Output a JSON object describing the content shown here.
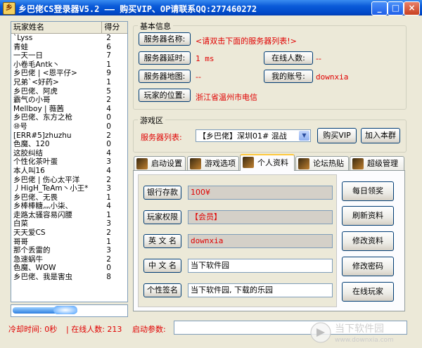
{
  "title": "乡巴佬CS登录器V5.2 —— 购买VIP、OP请联系QQ:277460272",
  "window_controls": {
    "min": "_",
    "max": "□",
    "close": "×"
  },
  "players": {
    "headers": [
      "玩家姓名",
      "得分"
    ],
    "rows": [
      [
        "`Lyss",
        "2"
      ],
      [
        "青蛙",
        "6"
      ],
      [
        "一天一日",
        "7"
      ],
      [
        "小卷毛Antk丶",
        "1"
      ],
      [
        "乡巴佬 | <恩平仔>",
        "9"
      ],
      [
        "兄弟`<好药>",
        "1"
      ],
      [
        "乡巴佬、阿虎",
        "5"
      ],
      [
        "霸气の小哥",
        "2"
      ],
      [
        "Mellboy | 薇茜",
        "4"
      ],
      [
        "乡巴佬、东方之枪",
        "0"
      ],
      [
        "⑩号",
        "0"
      ],
      [
        "[ERR#5]zhuzhu",
        "2"
      ],
      [
        "色魔、120",
        "0"
      ],
      [
        "这胶纠结",
        "4"
      ],
      [
        "个性化茶叶蛋",
        "3"
      ],
      [
        "本人叫16",
        "4"
      ],
      [
        "乡巴佬 | 伤心太平洋",
        "2"
      ],
      [
        "丿HigH_TeAm丶小王*",
        "3"
      ],
      [
        "乡巴佬、无畏",
        "1"
      ],
      [
        "乡棒棒糖灬小柒、",
        "4"
      ],
      [
        "走路太骚容易闪腰",
        "1"
      ],
      [
        "白菜",
        "3"
      ],
      [
        "天天爱CS",
        "2"
      ],
      [
        "哥哥",
        "1"
      ],
      [
        "那个丢雷的",
        "3"
      ],
      [
        "急速蜗牛",
        "2"
      ],
      [
        "色魔、WOW",
        "0"
      ],
      [
        "乡巴佬、我是害虫",
        "8"
      ]
    ]
  },
  "progress_fraction": 0.58,
  "basic_info": {
    "title": "基本信息",
    "server_name_label": "服务器名称:",
    "server_name_value": "<请双击下面的服务器列表!>",
    "latency_label": "服务器延时:",
    "latency_value": "1 ms",
    "online_label": "在线人数:",
    "online_value": "--",
    "map_label": "服务器地图:",
    "map_value": "--",
    "account_label": "我的账号:",
    "account_value": "downxia",
    "location_label": "玩家的位置:",
    "location_value": "浙江省温州市电信"
  },
  "game_zone": {
    "title": "游戏区",
    "server_list_label": "服务器列表:",
    "server_selected": "【乡巴佬】深圳01# 混战",
    "buy_vip": "购买VIP",
    "join_group": "加入本群"
  },
  "tabs": [
    "启动设置",
    "游戏选项",
    "个人资料",
    "论坛热贴",
    "超级管理"
  ],
  "active_tab": 2,
  "profile": {
    "bank_label": "银行存款",
    "bank_value": "100¥",
    "rights_label": "玩家权限",
    "rights_value": "【会员】",
    "en_name_label": "英 文 名",
    "en_name_value": "downxia",
    "cn_name_label": "中 文 名",
    "cn_name_value": "当下软件园",
    "sign_label": "个性签名",
    "sign_value": "当下软件园, 下载的乐园"
  },
  "actions": [
    "每日领奖",
    "刷新资料",
    "修改资料",
    "修改密码",
    "在线玩家"
  ],
  "status": {
    "cooldown": "冷却时间: 0秒",
    "online_count": "| 在线人数: 213",
    "launch_params_label": "启动参数:"
  },
  "watermark": {
    "line1": "当下软件园",
    "line2": "www.downxia.com"
  },
  "colors": {
    "title_blue": "#0a5ad8",
    "value_red": "#e00000",
    "window_bg": "#ece9d8"
  }
}
